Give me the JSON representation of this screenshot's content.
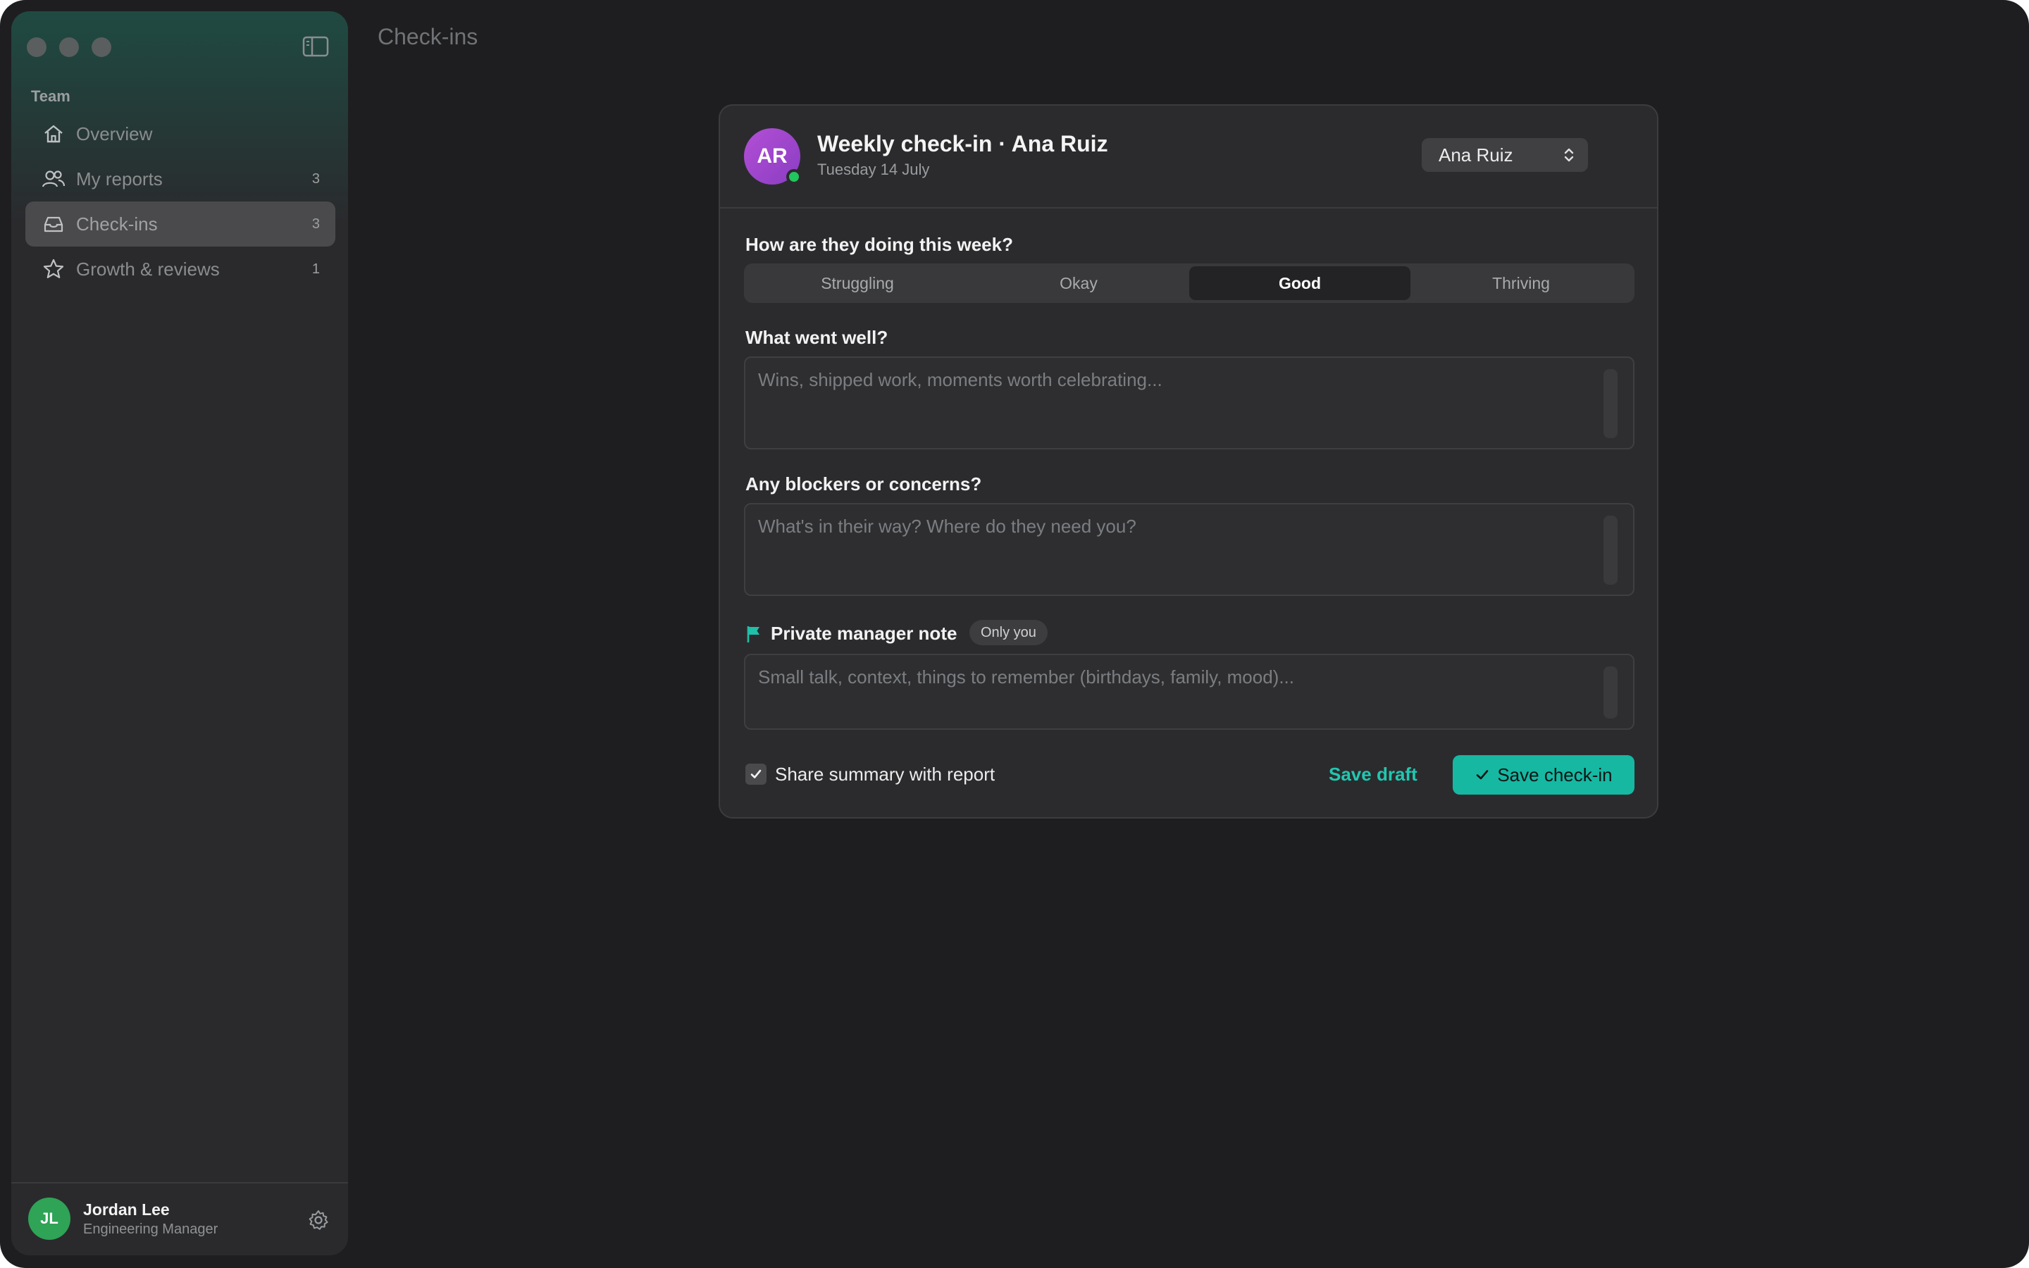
{
  "page": {
    "title": "Check-ins"
  },
  "sidebar": {
    "section": "Team",
    "items": [
      {
        "label": "Overview",
        "count": "",
        "icon": "home-icon"
      },
      {
        "label": "My reports",
        "count": "3",
        "icon": "users-icon"
      },
      {
        "label": "Check-ins",
        "count": "3",
        "icon": "inbox-icon",
        "active": true
      },
      {
        "label": "Growth & reviews",
        "count": "1",
        "icon": "star-icon"
      }
    ],
    "user": {
      "initials": "JL",
      "name": "Jordan Lee",
      "role": "Engineering Manager"
    }
  },
  "card": {
    "avatar_initials": "AR",
    "title": "Weekly check-in · Ana Ruiz",
    "date": "Tuesday 14 July",
    "person_select": "Ana Ruiz",
    "mood": {
      "question": "How are they doing this week?",
      "options": [
        "Struggling",
        "Okay",
        "Good",
        "Thriving"
      ],
      "selected": "Good"
    },
    "went_well": {
      "label": "What went well?",
      "placeholder": "Wins, shipped work, moments worth celebrating..."
    },
    "blockers": {
      "label": "Any blockers or concerns?",
      "placeholder": "What's in their way? Where do they need you?"
    },
    "private_note": {
      "label": "Private manager note",
      "badge": "Only you",
      "placeholder": "Small talk, context, things to remember (birthdays, family, mood)..."
    },
    "share_label": "Share summary with report",
    "share_checked": true,
    "save_draft": "Save draft",
    "save_checkin": "Save check-in"
  },
  "colors": {
    "accent": "#16b8a2",
    "avatar": "#9b45cf",
    "presence": "#22c55e",
    "user_avatar": "#2fa356"
  }
}
